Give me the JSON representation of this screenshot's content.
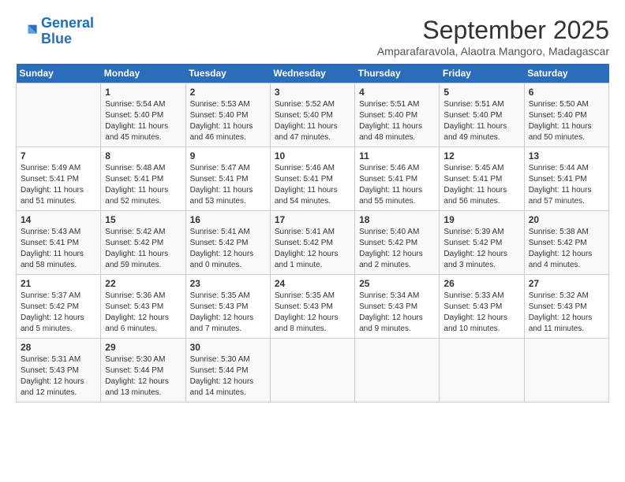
{
  "logo": {
    "line1": "General",
    "line2": "Blue"
  },
  "title": "September 2025",
  "subtitle": "Amparafaravola, Alaotra Mangoro, Madagascar",
  "days_of_week": [
    "Sunday",
    "Monday",
    "Tuesday",
    "Wednesday",
    "Thursday",
    "Friday",
    "Saturday"
  ],
  "weeks": [
    [
      {
        "day": "",
        "info": ""
      },
      {
        "day": "1",
        "info": "Sunrise: 5:54 AM\nSunset: 5:40 PM\nDaylight: 11 hours\nand 45 minutes."
      },
      {
        "day": "2",
        "info": "Sunrise: 5:53 AM\nSunset: 5:40 PM\nDaylight: 11 hours\nand 46 minutes."
      },
      {
        "day": "3",
        "info": "Sunrise: 5:52 AM\nSunset: 5:40 PM\nDaylight: 11 hours\nand 47 minutes."
      },
      {
        "day": "4",
        "info": "Sunrise: 5:51 AM\nSunset: 5:40 PM\nDaylight: 11 hours\nand 48 minutes."
      },
      {
        "day": "5",
        "info": "Sunrise: 5:51 AM\nSunset: 5:40 PM\nDaylight: 11 hours\nand 49 minutes."
      },
      {
        "day": "6",
        "info": "Sunrise: 5:50 AM\nSunset: 5:40 PM\nDaylight: 11 hours\nand 50 minutes."
      }
    ],
    [
      {
        "day": "7",
        "info": "Sunrise: 5:49 AM\nSunset: 5:41 PM\nDaylight: 11 hours\nand 51 minutes."
      },
      {
        "day": "8",
        "info": "Sunrise: 5:48 AM\nSunset: 5:41 PM\nDaylight: 11 hours\nand 52 minutes."
      },
      {
        "day": "9",
        "info": "Sunrise: 5:47 AM\nSunset: 5:41 PM\nDaylight: 11 hours\nand 53 minutes."
      },
      {
        "day": "10",
        "info": "Sunrise: 5:46 AM\nSunset: 5:41 PM\nDaylight: 11 hours\nand 54 minutes."
      },
      {
        "day": "11",
        "info": "Sunrise: 5:46 AM\nSunset: 5:41 PM\nDaylight: 11 hours\nand 55 minutes."
      },
      {
        "day": "12",
        "info": "Sunrise: 5:45 AM\nSunset: 5:41 PM\nDaylight: 11 hours\nand 56 minutes."
      },
      {
        "day": "13",
        "info": "Sunrise: 5:44 AM\nSunset: 5:41 PM\nDaylight: 11 hours\nand 57 minutes."
      }
    ],
    [
      {
        "day": "14",
        "info": "Sunrise: 5:43 AM\nSunset: 5:41 PM\nDaylight: 11 hours\nand 58 minutes."
      },
      {
        "day": "15",
        "info": "Sunrise: 5:42 AM\nSunset: 5:42 PM\nDaylight: 11 hours\nand 59 minutes."
      },
      {
        "day": "16",
        "info": "Sunrise: 5:41 AM\nSunset: 5:42 PM\nDaylight: 12 hours\nand 0 minutes."
      },
      {
        "day": "17",
        "info": "Sunrise: 5:41 AM\nSunset: 5:42 PM\nDaylight: 12 hours\nand 1 minute."
      },
      {
        "day": "18",
        "info": "Sunrise: 5:40 AM\nSunset: 5:42 PM\nDaylight: 12 hours\nand 2 minutes."
      },
      {
        "day": "19",
        "info": "Sunrise: 5:39 AM\nSunset: 5:42 PM\nDaylight: 12 hours\nand 3 minutes."
      },
      {
        "day": "20",
        "info": "Sunrise: 5:38 AM\nSunset: 5:42 PM\nDaylight: 12 hours\nand 4 minutes."
      }
    ],
    [
      {
        "day": "21",
        "info": "Sunrise: 5:37 AM\nSunset: 5:42 PM\nDaylight: 12 hours\nand 5 minutes."
      },
      {
        "day": "22",
        "info": "Sunrise: 5:36 AM\nSunset: 5:43 PM\nDaylight: 12 hours\nand 6 minutes."
      },
      {
        "day": "23",
        "info": "Sunrise: 5:35 AM\nSunset: 5:43 PM\nDaylight: 12 hours\nand 7 minutes."
      },
      {
        "day": "24",
        "info": "Sunrise: 5:35 AM\nSunset: 5:43 PM\nDaylight: 12 hours\nand 8 minutes."
      },
      {
        "day": "25",
        "info": "Sunrise: 5:34 AM\nSunset: 5:43 PM\nDaylight: 12 hours\nand 9 minutes."
      },
      {
        "day": "26",
        "info": "Sunrise: 5:33 AM\nSunset: 5:43 PM\nDaylight: 12 hours\nand 10 minutes."
      },
      {
        "day": "27",
        "info": "Sunrise: 5:32 AM\nSunset: 5:43 PM\nDaylight: 12 hours\nand 11 minutes."
      }
    ],
    [
      {
        "day": "28",
        "info": "Sunrise: 5:31 AM\nSunset: 5:43 PM\nDaylight: 12 hours\nand 12 minutes."
      },
      {
        "day": "29",
        "info": "Sunrise: 5:30 AM\nSunset: 5:44 PM\nDaylight: 12 hours\nand 13 minutes."
      },
      {
        "day": "30",
        "info": "Sunrise: 5:30 AM\nSunset: 5:44 PM\nDaylight: 12 hours\nand 14 minutes."
      },
      {
        "day": "",
        "info": ""
      },
      {
        "day": "",
        "info": ""
      },
      {
        "day": "",
        "info": ""
      },
      {
        "day": "",
        "info": ""
      }
    ]
  ]
}
